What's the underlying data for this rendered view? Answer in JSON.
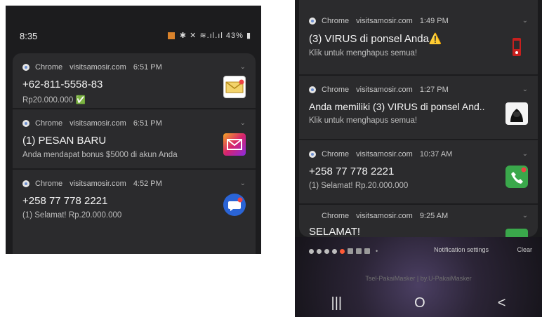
{
  "left": {
    "status": {
      "time": "8:35",
      "battery": "43%"
    },
    "notifications": [
      {
        "app": "Chrome",
        "site": "visitsamosir.com",
        "time": "6:51 PM",
        "title": "+62-811-5558-83",
        "body": "Rp20.000.000 ✅",
        "thumb": "mail-icon"
      },
      {
        "app": "Chrome",
        "site": "visitsamosir.com",
        "time": "6:51 PM",
        "title": "(1) PESAN BARU",
        "body": "Anda mendapat bonus $5000 di akun Anda",
        "thumb": "message-icon"
      },
      {
        "app": "Chrome",
        "site": "visitsamosir.com",
        "time": "4:52 PM",
        "title": "+258 77 778 2221",
        "body": "(1) Selamat! Rp.20.000.000",
        "thumb": "chat-bubble-icon"
      }
    ]
  },
  "right": {
    "notifications": [
      {
        "app": "Chrome",
        "site": "visitsamosir.com",
        "time": "1:49 PM",
        "title": "(3) VIRUS di ponsel Anda⚠️",
        "body": "Klik untuk menghapus semua!",
        "thumb": "phone-alert-icon"
      },
      {
        "app": "Chrome",
        "site": "visitsamosir.com",
        "time": "1:27 PM",
        "title": "Anda memiliki (3) VIRUS di ponsel And..",
        "body": "Klik untuk menghapus semua!",
        "thumb": "hacker-icon"
      },
      {
        "app": "Chrome",
        "site": "visitsamosir.com",
        "time": "10:37 AM",
        "title": "+258 77 778 2221",
        "body": "(1) Selamat! Rp.20.000.000",
        "thumb": "phone-call-icon"
      },
      {
        "app": "Chrome",
        "site": "visitsamosir.com",
        "time": "9:25 AM",
        "title": "SELAMAT!",
        "body": "",
        "thumb": "green-icon"
      }
    ],
    "bottom": {
      "settings_label": "Notification settings",
      "clear_label": "Clear",
      "footer": "Tsel-PakaiMasker | by.U-PakaiMasker"
    },
    "nav": {
      "recents": "|||",
      "home": "O",
      "back": "<"
    }
  },
  "colors": {
    "panel": "#2b2b2d",
    "background": "#1c1c1e",
    "accent_green": "#3aa84b",
    "warning": "#f2c230"
  }
}
